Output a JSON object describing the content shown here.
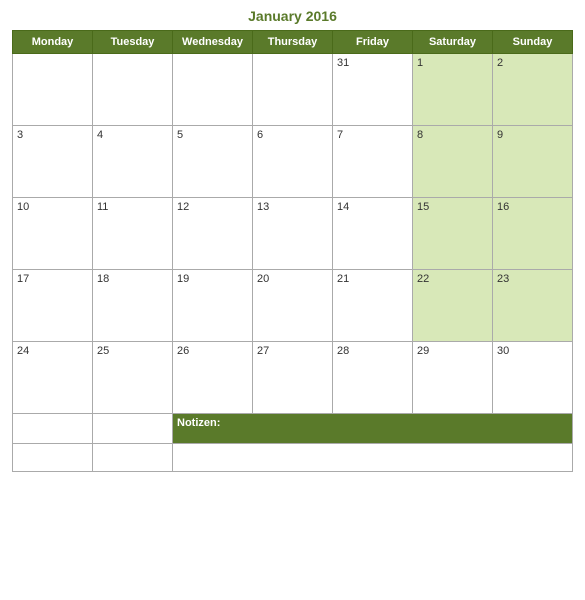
{
  "title": "January 2016",
  "headers": [
    "Monday",
    "Tuesday",
    "Wednesday",
    "Thursday",
    "Friday",
    "Saturday",
    "Sunday"
  ],
  "weeks": [
    [
      {
        "num": "",
        "weekend": false
      },
      {
        "num": "",
        "weekend": false
      },
      {
        "num": "",
        "weekend": false
      },
      {
        "num": "",
        "weekend": false
      },
      {
        "num": "31",
        "weekend": false
      },
      {
        "num": "1",
        "weekend": true
      },
      {
        "num": "2",
        "weekend": true
      }
    ],
    [
      {
        "num": "3",
        "weekend": false
      },
      {
        "num": "4",
        "weekend": false
      },
      {
        "num": "5",
        "weekend": false
      },
      {
        "num": "6",
        "weekend": false
      },
      {
        "num": "7",
        "weekend": false
      },
      {
        "num": "8",
        "weekend": true
      },
      {
        "num": "9",
        "weekend": true
      }
    ],
    [
      {
        "num": "10",
        "weekend": false
      },
      {
        "num": "11",
        "weekend": false
      },
      {
        "num": "12",
        "weekend": false
      },
      {
        "num": "13",
        "weekend": false
      },
      {
        "num": "14",
        "weekend": false
      },
      {
        "num": "15",
        "weekend": true
      },
      {
        "num": "16",
        "weekend": true
      }
    ],
    [
      {
        "num": "17",
        "weekend": false
      },
      {
        "num": "18",
        "weekend": false
      },
      {
        "num": "19",
        "weekend": false
      },
      {
        "num": "20",
        "weekend": false
      },
      {
        "num": "21",
        "weekend": false
      },
      {
        "num": "22",
        "weekend": true
      },
      {
        "num": "23",
        "weekend": true
      }
    ],
    [
      {
        "num": "24",
        "weekend": false
      },
      {
        "num": "25",
        "weekend": false
      },
      {
        "num": "26",
        "weekend": false
      },
      {
        "num": "27",
        "weekend": false
      },
      {
        "num": "28",
        "weekend": false
      },
      {
        "num": "29",
        "weekend": false
      },
      {
        "num": "30",
        "weekend": false
      }
    ]
  ],
  "notes_label": "Notizen:"
}
